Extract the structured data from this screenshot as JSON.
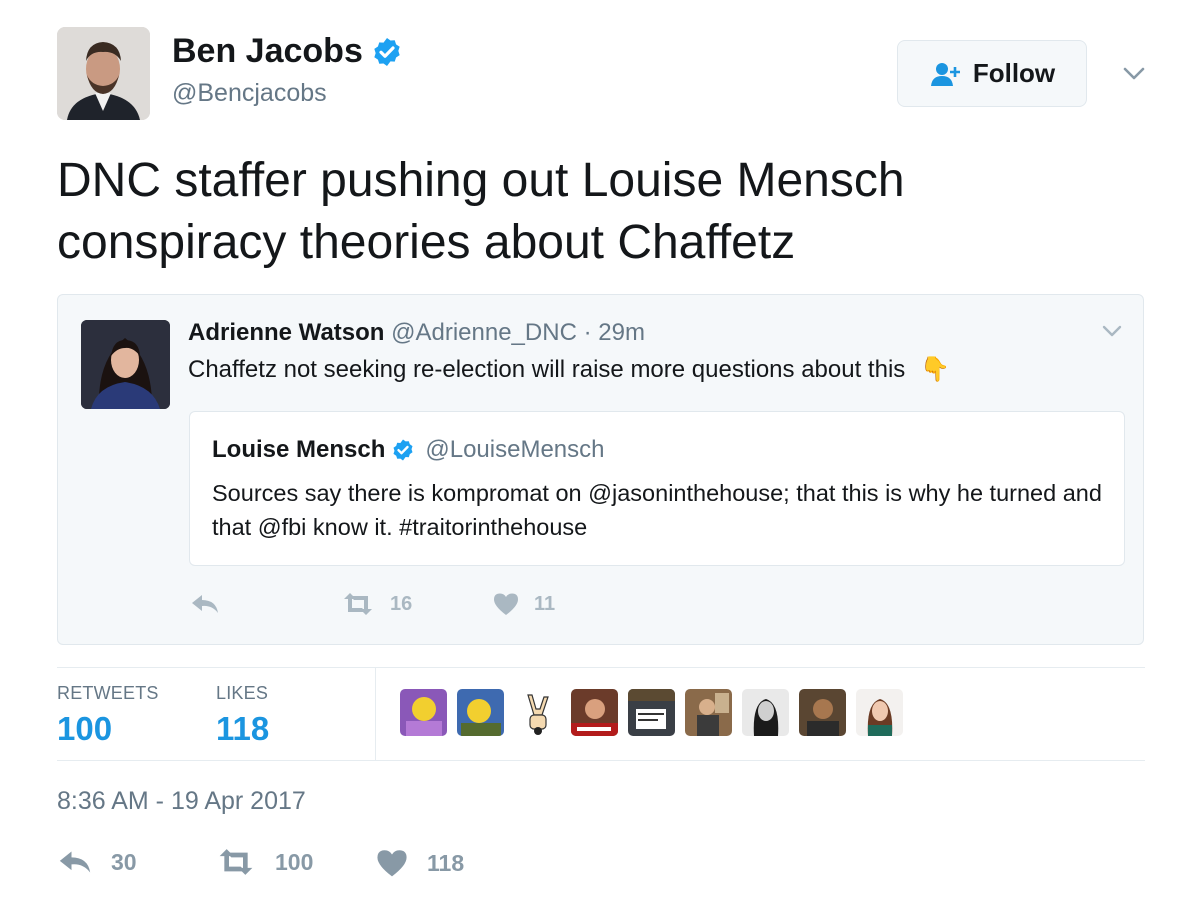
{
  "author": {
    "name": "Ben Jacobs",
    "handle": "@Bencjacobs",
    "verified": true
  },
  "follow_button": {
    "label": "Follow",
    "icon": "add-user-icon"
  },
  "tweet": {
    "text": "DNC staffer pushing out Louise Mensch conspiracy theories about Chaffetz"
  },
  "quoted_tweet": {
    "name": "Adrienne Watson",
    "handle": "@Adrienne_DNC",
    "separator": "·",
    "time": "29m",
    "text": "Chaffetz not seeking re-election will raise more questions about this",
    "emoji": "👇",
    "inner_quote": {
      "name": "Louise Mensch",
      "verified": true,
      "handle": "@LouiseMensch",
      "text": "Sources say there is kompromat on @jasoninthehouse; that this is why he turned and that @fbi know it. #traitorinthehouse"
    },
    "actions": {
      "retweets": "16",
      "likes": "11"
    }
  },
  "stats": {
    "retweets_label": "RETWEETS",
    "retweets_value": "100",
    "likes_label": "LIKES",
    "likes_value": "118"
  },
  "timestamp": "8:36 AM - 19 Apr 2017",
  "bottom_actions": {
    "replies": "30",
    "retweets": "100",
    "likes": "118"
  },
  "colors": {
    "accent": "#1b95e0",
    "verified": "#1da1f2",
    "muted": "#657786",
    "icon": "#aab8c2"
  }
}
